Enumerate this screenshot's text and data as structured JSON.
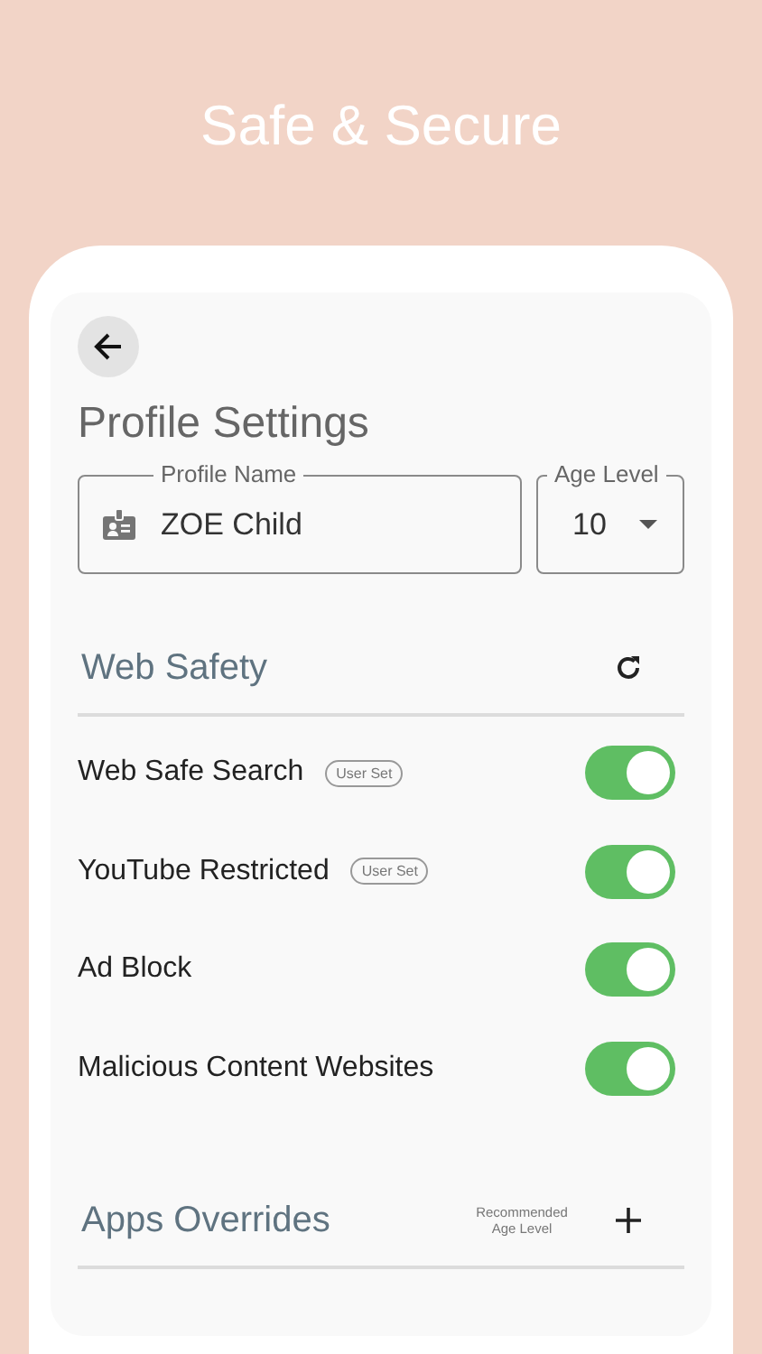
{
  "headline": "Safe & Secure",
  "page": {
    "title": "Profile Settings"
  },
  "profile_name": {
    "label": "Profile Name",
    "value": "ZOE Child"
  },
  "age_level": {
    "label": "Age Level",
    "value": "10"
  },
  "web_safety": {
    "title": "Web Safety",
    "items": [
      {
        "label": "Web Safe Search",
        "badge": "User Set",
        "on": true
      },
      {
        "label": "YouTube Restricted",
        "badge": "User Set",
        "on": true
      },
      {
        "label": "Ad Block",
        "on": true
      },
      {
        "label": "Malicious Content Websites",
        "on": true
      }
    ]
  },
  "apps_overrides": {
    "title": "Apps Overrides",
    "note": "Recommended Age Level"
  }
}
